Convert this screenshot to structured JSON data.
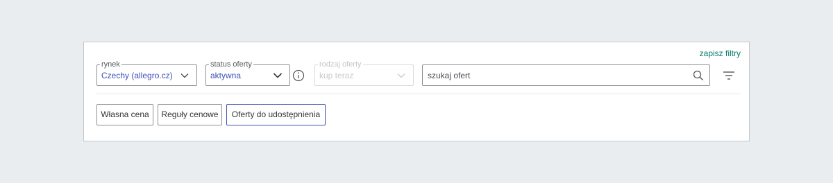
{
  "save_filters": "zapisz filtry",
  "filters": {
    "market": {
      "label": "rynek",
      "value": "Czechy (allegro.cz)"
    },
    "status": {
      "label": "status oferty",
      "value": "aktywna"
    },
    "type": {
      "label": "rodzaj oferty",
      "value": "kup teraz",
      "disabled": true
    }
  },
  "search": {
    "placeholder": "szukaj ofert"
  },
  "tabs": [
    {
      "label": "Własna cena",
      "active": false
    },
    {
      "label": "Reguły cenowe",
      "active": false
    },
    {
      "label": "Oferty do udostępnienia",
      "active": true
    }
  ],
  "colors": {
    "accent": "#3f51b5",
    "link": "#00796b",
    "background": "#eaedf0"
  },
  "icons": {
    "chevron": "chevron-down-icon",
    "info": "info-icon",
    "search": "search-icon",
    "filter": "filter-icon"
  }
}
